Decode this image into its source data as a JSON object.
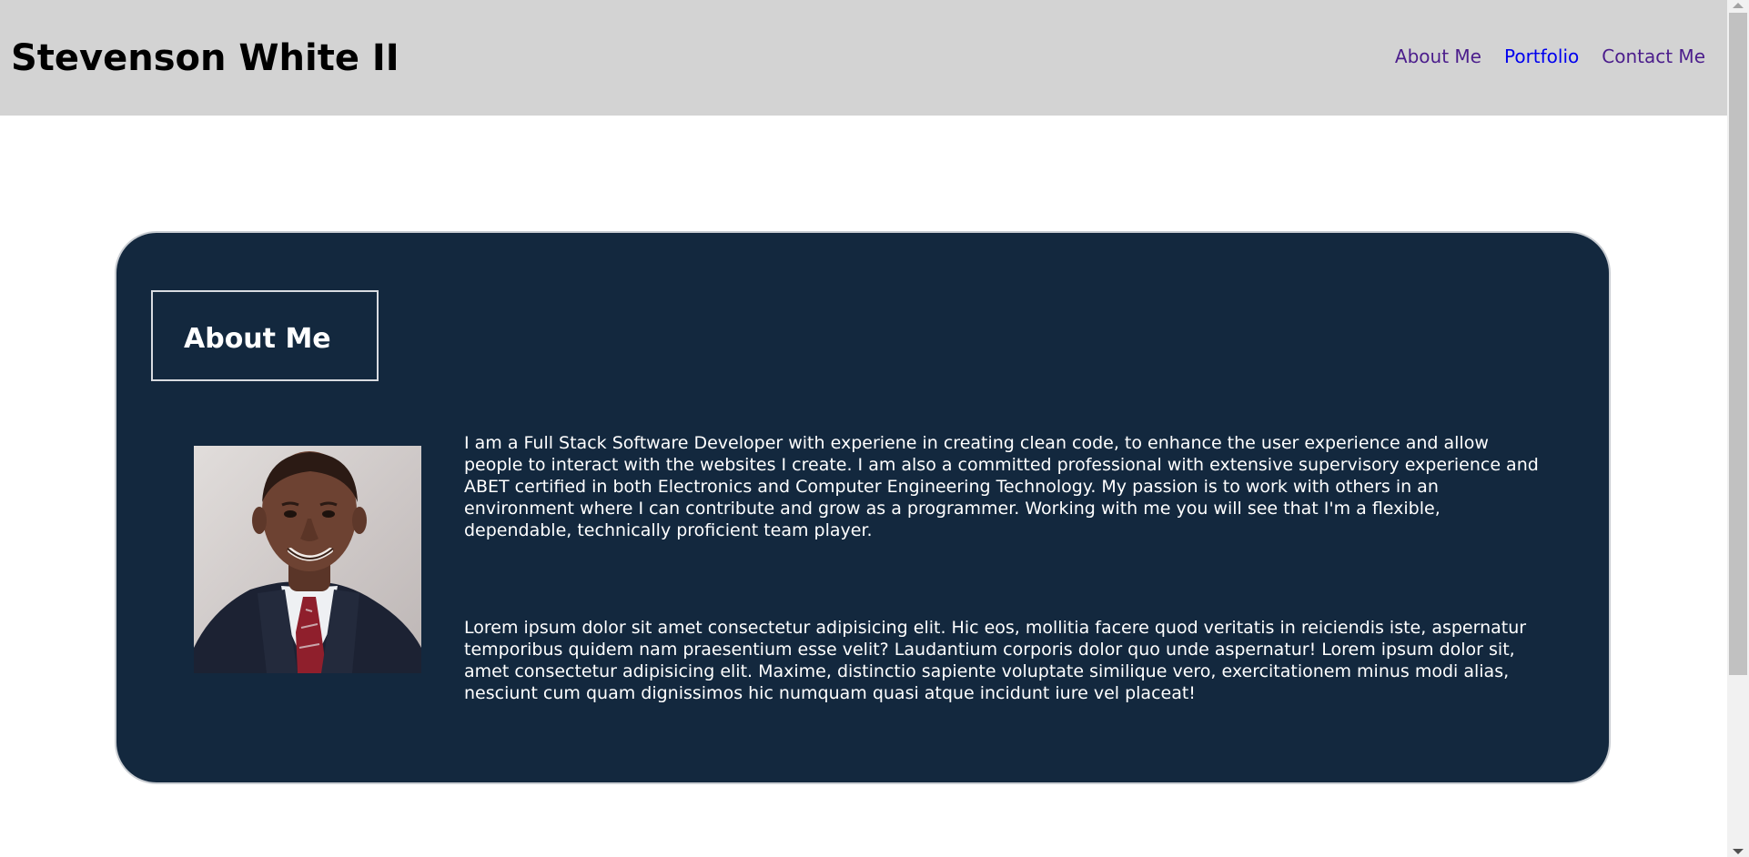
{
  "header": {
    "title": "Stevenson White II",
    "nav": [
      "About Me",
      "Portfolio",
      "Contact Me"
    ]
  },
  "about": {
    "heading": "About Me",
    "photo_alt": "Portrait of Stevenson White II",
    "paragraph1": "I am a Full Stack Software Developer with experiene in creating clean code, to enhance the user experience and allow people to interact with the websites I create. I am also a committed professional with extensive supervisory experience and ABET certified in both Electronics and Computer Engineering Technology. My passion is to work with others in an environment where I can contribute and grow as a programmer. Working with me you will see that I'm a flexible, dependable, technically proficient team player.",
    "paragraph2": "Lorem ipsum dolor sit amet consectetur adipisicing elit. Hic eos, mollitia facere quod veritatis in reiciendis iste, aspernatur temporibus quidem nam praesentium esse velit? Laudantium corporis dolor quo unde aspernatur! Lorem ipsum dolor sit, amet consectetur adipisicing elit. Maxime, distinctio sapiente voluptate similique vero, exercitationem minus modi alias, nesciunt cum quam dignissimos hic numquam quasi atque incidunt iure vel placeat!"
  },
  "colors": {
    "header_bg": "#d3d3d3",
    "card_bg": "#13283e",
    "visited_link": "#4b1d8c",
    "link": "#0000ee"
  },
  "icons": [
    "scroll-up-arrow-icon",
    "scroll-down-arrow-icon"
  ]
}
